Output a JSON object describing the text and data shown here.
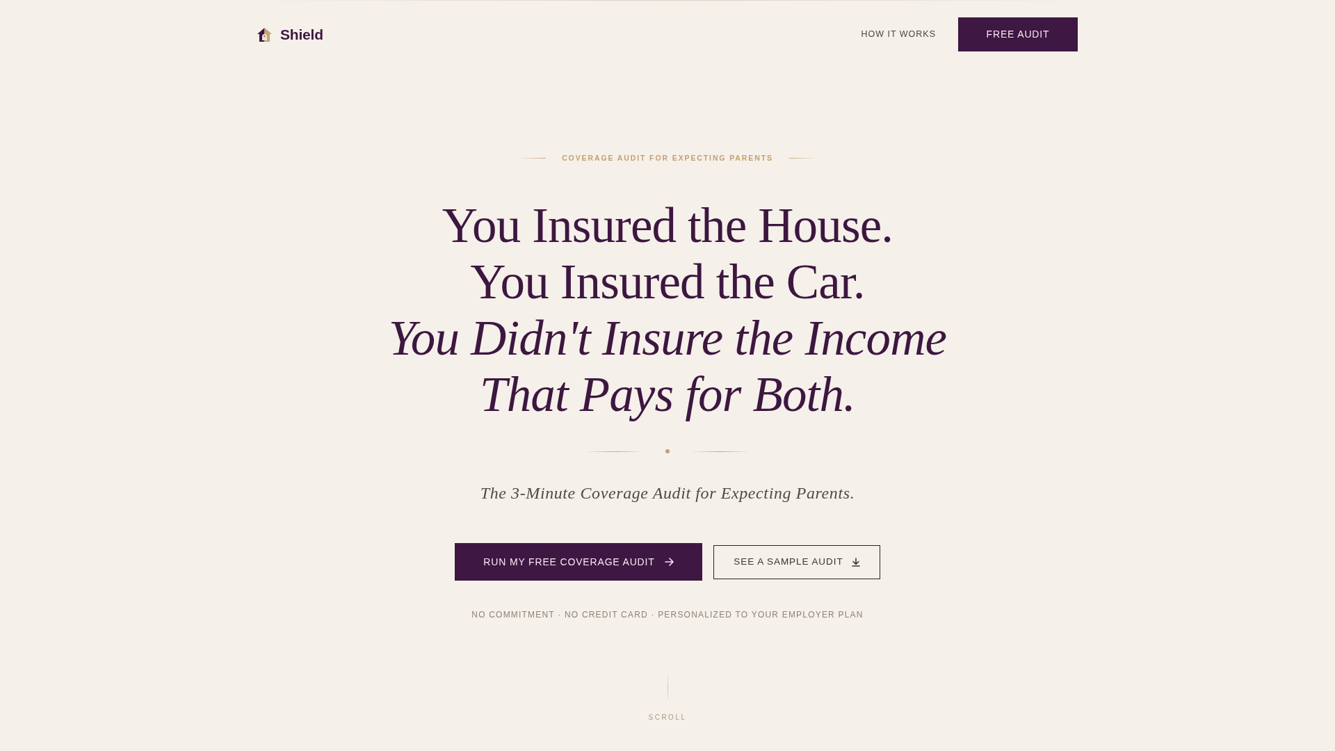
{
  "header": {
    "brand": "Shield",
    "nav": [
      "HOW IT WORKS"
    ],
    "cta": "FREE AUDIT"
  },
  "hero": {
    "eyebrow": "COVERAGE AUDIT FOR EXPECTING PARENTS",
    "headline": [
      {
        "text": "You Insured the House.",
        "italic": false
      },
      {
        "text": "You Insured the Car.",
        "italic": false
      },
      {
        "text": "You Didn't Insure the Income",
        "italic": true
      },
      {
        "text": "That Pays for Both.",
        "italic": true
      }
    ],
    "subtitle": "The 3-Minute Coverage Audit for Expecting Parents.",
    "buttons": [
      {
        "label": "RUN MY FREE COVERAGE AUDIT",
        "kind": "primary"
      },
      {
        "label": "SEE A SAMPLE AUDIT",
        "kind": "secondary"
      }
    ],
    "note": "NO COMMITMENT · NO CREDIT CARD · PERSONALIZED TO YOUR EMPLOYER PLAN"
  },
  "scroll_hint": "SCROLL"
}
